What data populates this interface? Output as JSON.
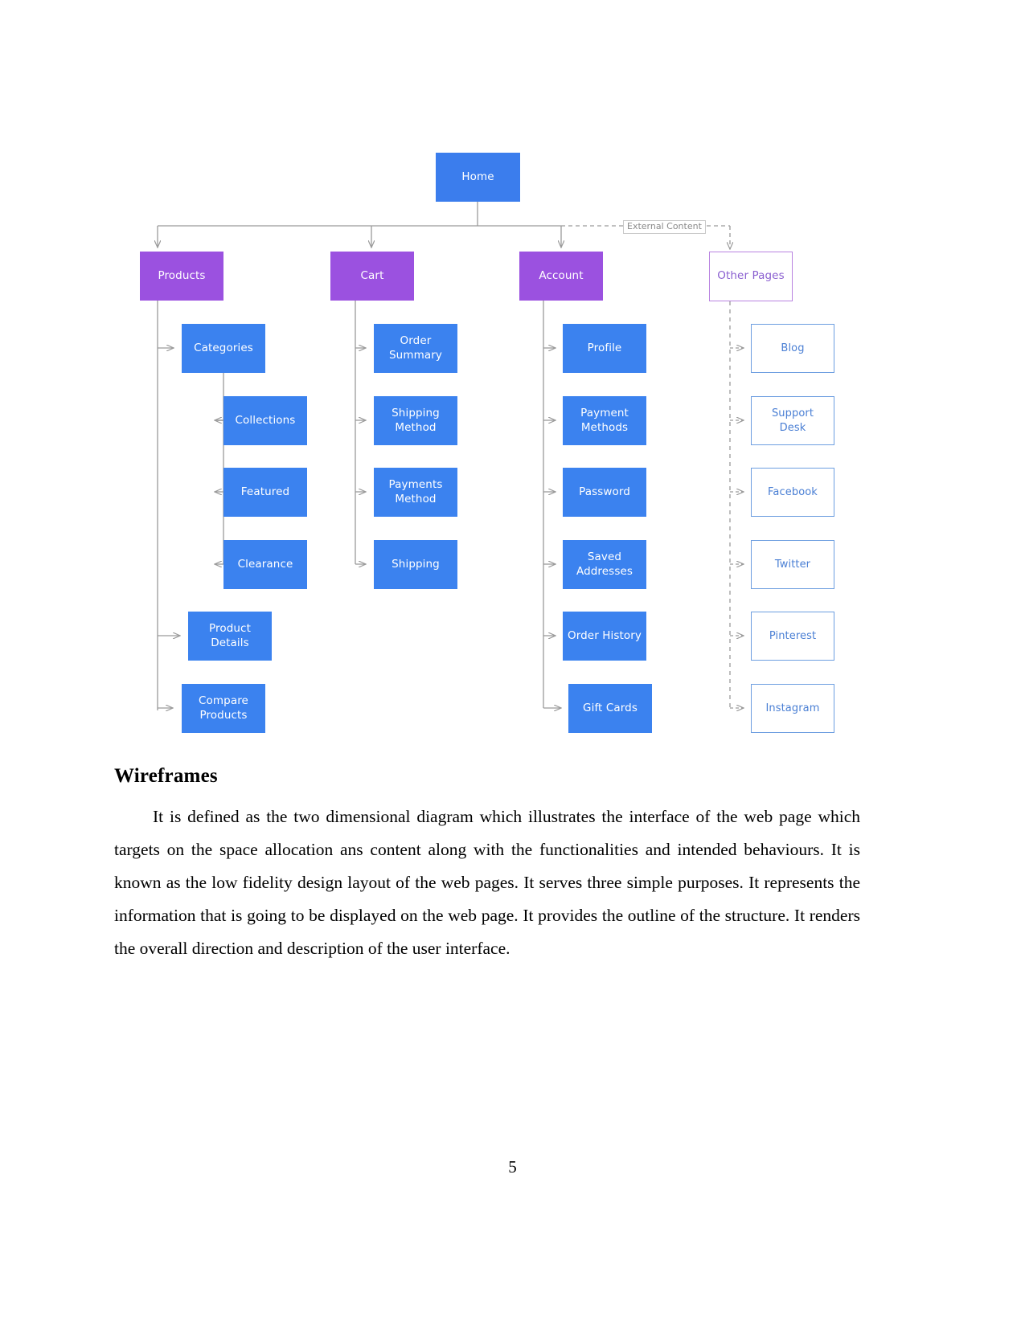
{
  "document": {
    "heading": "Wireframes",
    "paragraph": "It is defined as the two dimensional diagram which illustrates the interface of the web page which targets on the space allocation ans content along with the functionalities and intended behaviours. It is known as the low fidelity design layout of the web pages. It serves three simple purposes. It represents the information that is going to be displayed on the web page. It provides the outline of the structure. It renders the overall direction and description of the user interface.",
    "page_number": "5"
  },
  "diagram": {
    "type": "sitemap-tree",
    "colors": {
      "root": "#3b7ded",
      "section": "#9b51e0",
      "leaf": "#3b82ef",
      "ghost_border": "#b983e0",
      "ghost_text": "#8a5fd0",
      "external_border": "#6d9ee0",
      "external_text": "#4a7fd4",
      "connector": "#9a9a9a",
      "dashed_connector": "#9a9a9a",
      "label_text": "#8a8a8a"
    },
    "root": {
      "label": "Home"
    },
    "edge_labels": [
      {
        "label": "External Content"
      }
    ],
    "branches": [
      {
        "label": "Products",
        "children": [
          {
            "label": "Categories",
            "children": [
              {
                "label": "Collections"
              },
              {
                "label": "Featured"
              },
              {
                "label": "Clearance"
              }
            ]
          },
          {
            "label": "Product\nDetails"
          },
          {
            "label": "Compare\nProducts"
          }
        ]
      },
      {
        "label": "Cart",
        "children": [
          {
            "label": "Order\nSummary"
          },
          {
            "label": "Shipping\nMethod"
          },
          {
            "label": "Payments\nMethod"
          },
          {
            "label": "Shipping"
          }
        ]
      },
      {
        "label": "Account",
        "children": [
          {
            "label": "Profile"
          },
          {
            "label": "Payment\nMethods"
          },
          {
            "label": "Password"
          },
          {
            "label": "Saved\nAddresses"
          },
          {
            "label": "Order History"
          },
          {
            "label": "Gift Cards"
          }
        ]
      },
      {
        "label": "Other Pages",
        "style": "ghost",
        "children": [
          {
            "label": "Blog"
          },
          {
            "label": "Support\nDesk"
          },
          {
            "label": "Facebook"
          },
          {
            "label": "Twitter"
          },
          {
            "label": "Pinterest"
          },
          {
            "label": "Instagram"
          }
        ]
      }
    ]
  }
}
